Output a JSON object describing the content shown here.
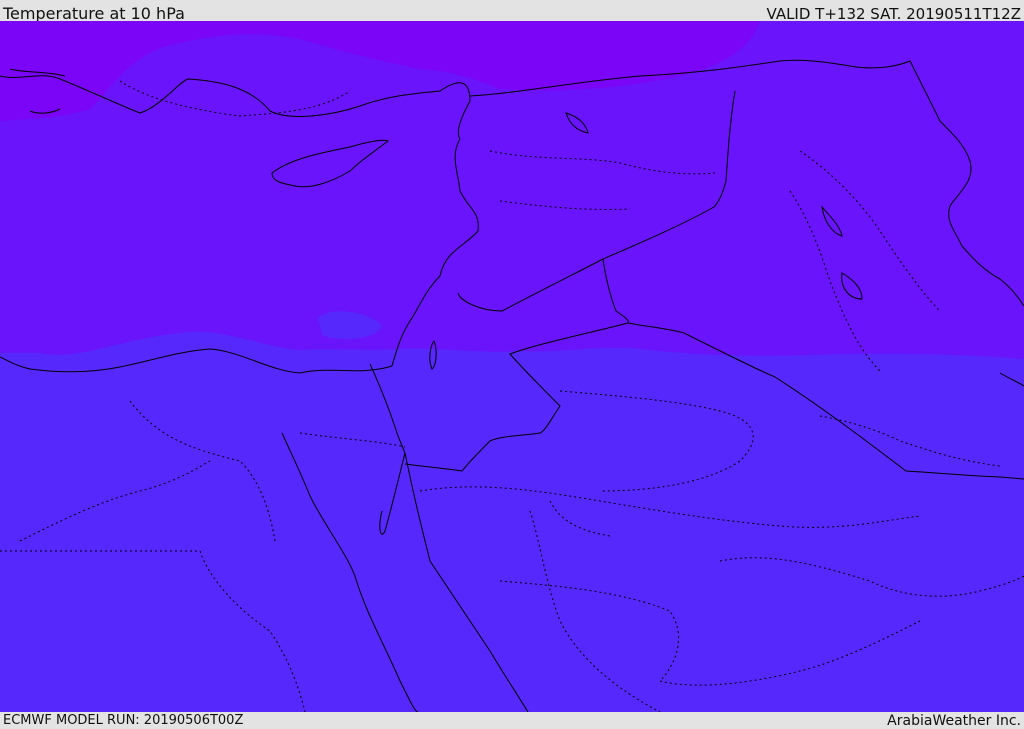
{
  "header": {
    "title": "Temperature at 10 hPa",
    "valid": "VALID T+132 SAT. 20190511T12Z"
  },
  "footer": {
    "model_run": "ECMWF MODEL RUN: 20190506T00Z",
    "credit": "ArabiaWeather Inc."
  },
  "map": {
    "colors": {
      "north_band": "#6a14fb",
      "north_edge_band": "#7b05f6",
      "south_band": "#5628fc",
      "coastline": "#000000",
      "borders": "#000000"
    }
  }
}
